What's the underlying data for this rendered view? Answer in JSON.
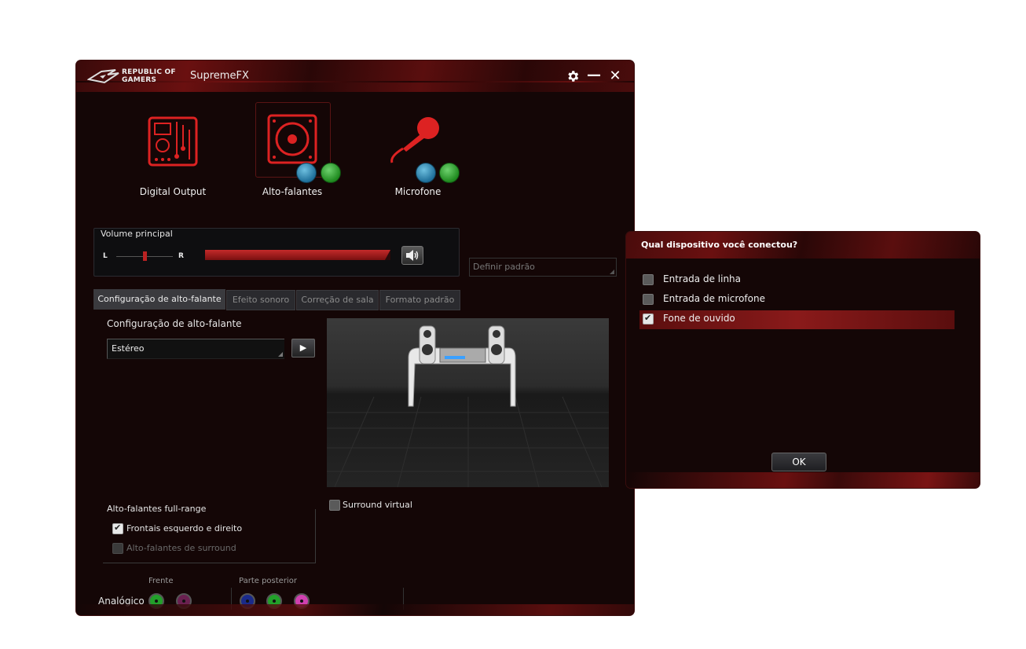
{
  "window": {
    "brand_line1": "REPUBLIC OF",
    "brand_line2": "GAMERS",
    "title": "SupremeFX",
    "settings_icon": "gear-icon",
    "minimize_symbol": "—",
    "close_symbol": "✕"
  },
  "devices": [
    {
      "label": "Digital Output",
      "icon": "circuit-board-icon"
    },
    {
      "label": "Alto-falantes",
      "icon": "speaker-icon",
      "selected": true
    },
    {
      "label": "Microfone",
      "icon": "microphone-icon"
    }
  ],
  "volume": {
    "title": "Volume principal",
    "left_label": "L",
    "right_label": "R",
    "balance": 0.5,
    "level": 1.0
  },
  "default_button": "Definir padrão",
  "tabs": [
    {
      "label": "Configuração de alto-falante",
      "active": true
    },
    {
      "label": "Efeito sonoro"
    },
    {
      "label": "Correção de sala"
    },
    {
      "label": "Formato padrão"
    }
  ],
  "speaker_config": {
    "label": "Configuração de alto-falante",
    "selected": "Estéreo",
    "play_symbol": "▶"
  },
  "surround_virtual": {
    "label": "Surround virtual",
    "checked": false
  },
  "full_range": {
    "title": "Alto-falantes full-range",
    "items": [
      {
        "label": "Frontais esquerdo e direito",
        "checked": true,
        "enabled": true
      },
      {
        "label": "Alto-falantes de surround",
        "checked": false,
        "enabled": false
      }
    ]
  },
  "jacks": {
    "row_label": "Analógico",
    "front_label": "Frente",
    "rear_label": "Parte posterior",
    "colors": {
      "front_green": "#22a02a",
      "front_pink": "#6a2050",
      "rear_blue": "#1a2a8a",
      "rear_green": "#22a02a",
      "rear_pink": "#d040b0"
    }
  },
  "dialog": {
    "title": "Qual dispositivo você conectou?",
    "options": [
      {
        "label": "Entrada de linha",
        "checked": false
      },
      {
        "label": "Entrada de microfone",
        "checked": false
      },
      {
        "label": "Fone de ouvido",
        "checked": true
      }
    ],
    "ok_label": "OK"
  },
  "colors": {
    "accent": "#c0202a",
    "background": "#140606"
  }
}
